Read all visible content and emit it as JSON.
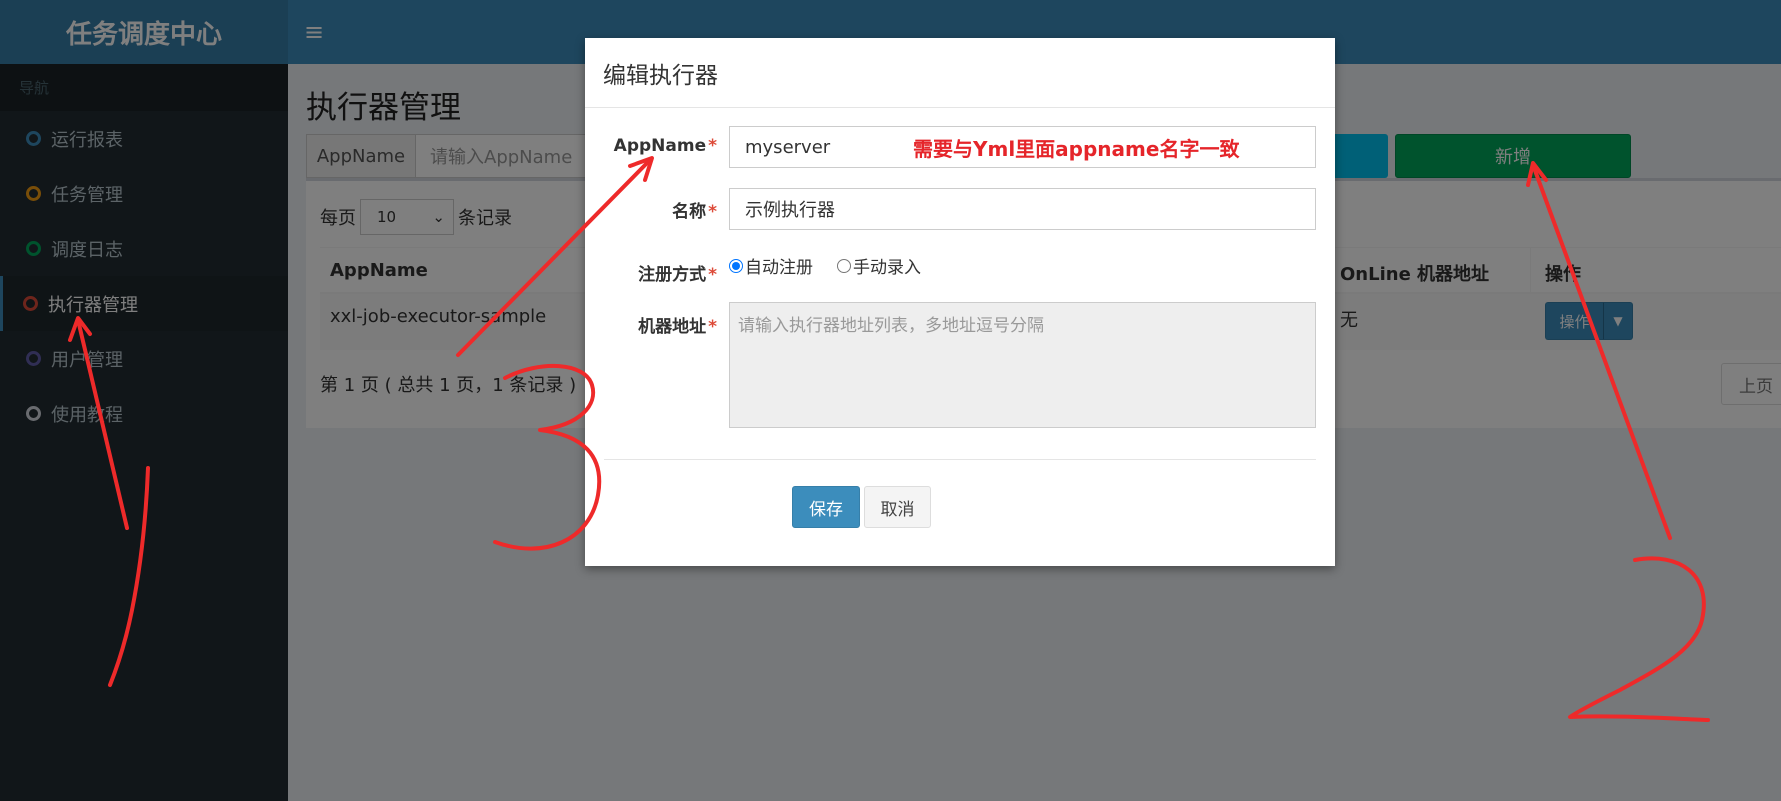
{
  "sidebar": {
    "brand": "任务调度中心",
    "nav_header": "导航",
    "items": [
      {
        "label": "运行报表",
        "color": "#3c8dbc"
      },
      {
        "label": "任务管理",
        "color": "#f39c12"
      },
      {
        "label": "调度日志",
        "color": "#00a65a"
      },
      {
        "label": "执行器管理",
        "color": "#dd4b39",
        "active": true
      },
      {
        "label": "用户管理",
        "color": "#605ca8"
      },
      {
        "label": "使用教程",
        "color": "#d2d6de"
      }
    ]
  },
  "header": {
    "menu_icon": "≡"
  },
  "main": {
    "title": "执行器管理",
    "search": {
      "addon": "AppName",
      "placeholder": "请输入AppName"
    },
    "add_button": "新增",
    "length": {
      "prefix": "每页",
      "value": "10",
      "suffix": "条记录"
    },
    "table": {
      "headers": [
        "AppName",
        "",
        "OnLine 机器地址",
        "操作"
      ],
      "rows": [
        {
          "appname": "xxl-job-executor-sample",
          "online": "无",
          "action": "操作"
        }
      ]
    },
    "page_info": "第 1 页 ( 总共 1 页，1 条记录 )",
    "prev_button": "上页"
  },
  "modal": {
    "title": "编辑执行器",
    "fields": {
      "appname": {
        "label": "AppName",
        "value": "myserver"
      },
      "name": {
        "label": "名称",
        "value": "示例执行器"
      },
      "register": {
        "label": "注册方式",
        "option_auto": "自动注册",
        "option_manual": "手动录入",
        "selected": "自动注册"
      },
      "address": {
        "label": "机器地址",
        "placeholder": "请输入执行器地址列表，多地址逗号分隔"
      }
    },
    "save_button": "保存",
    "cancel_button": "取消",
    "required_mark": "*"
  },
  "annotation": {
    "note": "需要与Yml里面appname名字一致",
    "color": "#e5252a"
  }
}
